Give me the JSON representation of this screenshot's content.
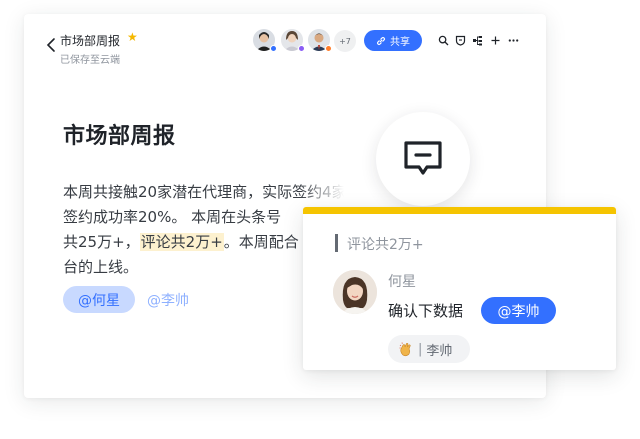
{
  "header": {
    "title": "市场部周报",
    "subtitle": "已保存至云端",
    "collaborators_more": "+7",
    "share_label": "共享",
    "icons": [
      "back-icon",
      "star-icon",
      "share-link-icon",
      "search-icon",
      "shield-icon",
      "doc-structure-icon",
      "add-icon",
      "more-icon"
    ]
  },
  "document": {
    "heading": "市场部周报",
    "line1": "本周共接触20家潜在代理商，实际签约4家",
    "line2": "签约成功率20%。 本周在头条号",
    "line3_before": "共25万+，",
    "line3_highlight": "评论共2万+",
    "line3_after": "。本周配合",
    "line4": "台的上线。",
    "mention_active": "@何星",
    "mention_plain": "@李帅"
  },
  "comment": {
    "quote": "评论共2万+",
    "author": "何星",
    "text": "确认下数据",
    "mention": "@李帅",
    "reaction_user": "李帅",
    "reaction_sep": "|"
  },
  "colors": {
    "accent": "#3370ff",
    "highlight": "#fdf1cf",
    "comment_top": "#f5c400",
    "star": "#f5b800"
  }
}
